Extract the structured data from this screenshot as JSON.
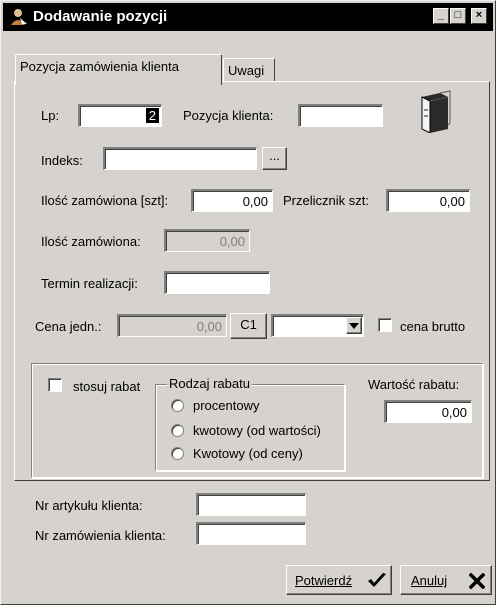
{
  "window": {
    "title": "Dodawanie pozycji",
    "minimize_glyph": "_",
    "maximize_glyph": "□",
    "close_glyph": "×",
    "icon": "user-add-icon"
  },
  "tabs": [
    {
      "label": "Pozycja zamówienia klienta",
      "active": true
    },
    {
      "label": "Uwagi",
      "active": false
    }
  ],
  "form": {
    "lp_label": "Lp:",
    "lp_value": "2",
    "pozycja_klienta_label": "Pozycja klienta:",
    "pozycja_klienta_value": "",
    "indeks_label": "Indeks:",
    "indeks_value": "",
    "indeks_browse": "...",
    "ilosc_zamowiona_szt_label": "Ilość zamówiona [szt]:",
    "ilosc_zamowiona_szt_value": "0,00",
    "przelicznik_label": "Przelicznik szt:",
    "przelicznik_value": "0,00",
    "ilosc_zamowiona_label": "Ilość zamówiona:",
    "ilosc_zamowiona_value": "0,00",
    "termin_label": "Termin realizacji:",
    "termin_value": "",
    "cena_label": "Cena jedn.:",
    "cena_value": "0,00",
    "c1_button": "C1",
    "currency_value": "",
    "cena_brutto_label": "cena brutto",
    "cena_brutto_checked": false,
    "book_icon": "book-icon"
  },
  "rabat": {
    "stosuj_label": "stosuj rabat",
    "stosuj_checked": false,
    "rodzaj_title": "Rodzaj rabatu",
    "options": [
      "procentowy",
      "kwotowy (od wartości)",
      "Kwotowy (od ceny)"
    ],
    "wartosc_label": "Wartość rabatu:",
    "wartosc_value": "0,00"
  },
  "bottom": {
    "nr_artykulu_label": "Nr artykułu klienta:",
    "nr_artykulu_value": "",
    "nr_zamowienia_label": "Nr zamówienia klienta:",
    "nr_zamowienia_value": ""
  },
  "footer": {
    "confirm_label": "Potwierdź",
    "cancel_label": "Anuluj"
  }
}
